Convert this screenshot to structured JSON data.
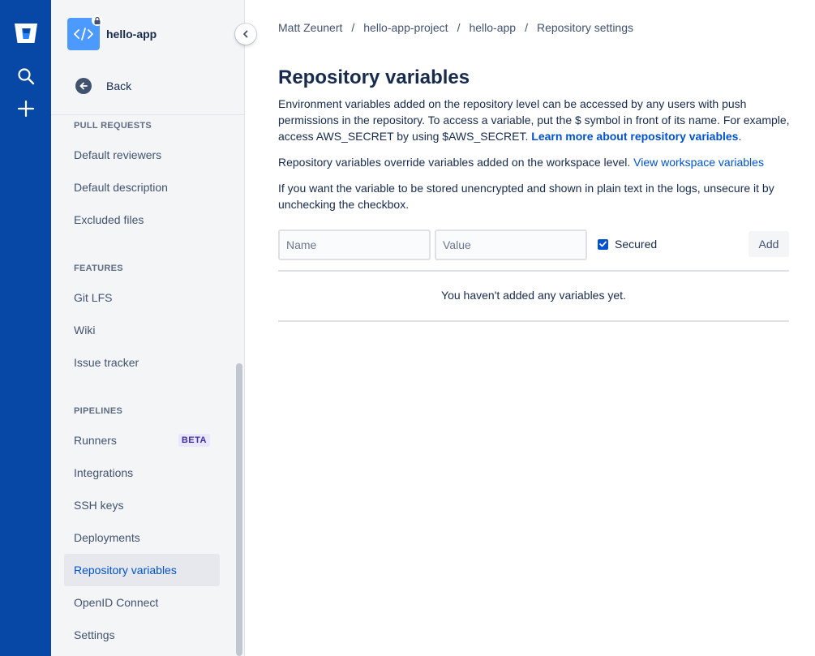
{
  "sidebar": {
    "repo_name": "hello-app",
    "back_label": "Back",
    "sections": {
      "pull_requests": "PULL REQUESTS",
      "features": "FEATURES",
      "pipelines": "PIPELINES"
    },
    "items": {
      "default_reviewers": "Default reviewers",
      "default_description": "Default description",
      "excluded_files": "Excluded files",
      "git_lfs": "Git LFS",
      "wiki": "Wiki",
      "issue_tracker": "Issue tracker",
      "runners": "Runners",
      "runners_badge": "BETA",
      "integrations": "Integrations",
      "ssh_keys": "SSH keys",
      "deployments": "Deployments",
      "repository_variables": "Repository variables",
      "openid_connect": "OpenID Connect",
      "settings": "Settings"
    }
  },
  "breadcrumbs": [
    "Matt Zeunert",
    "hello-app-project",
    "hello-app",
    "Repository settings"
  ],
  "breadcrumb_separator": "/",
  "main": {
    "title": "Repository variables",
    "para1": "Environment variables added on the repository level can be accessed by any users with push permissions in the repository. To access a variable, put the $ symbol in front of its name. For example, access AWS_SECRET by using $AWS_SECRET.",
    "para1_link": "Learn more about repository variables",
    "para1_end": ".",
    "para2": "Repository variables override variables added on the workspace level.",
    "para2_link": "View workspace variables",
    "para3": "If you want the variable to be stored unencrypted and shown in plain text in the logs, unsecure it by unchecking the checkbox.",
    "form": {
      "name_placeholder": "Name",
      "value_placeholder": "Value",
      "secured_label": "Secured",
      "secured_checked": true,
      "add_label": "Add"
    },
    "empty_message": "You haven't added any variables yet."
  },
  "colors": {
    "global_nav": "#0747a6",
    "link": "#0052cc",
    "active_item_bg": "#e6e8ed"
  }
}
